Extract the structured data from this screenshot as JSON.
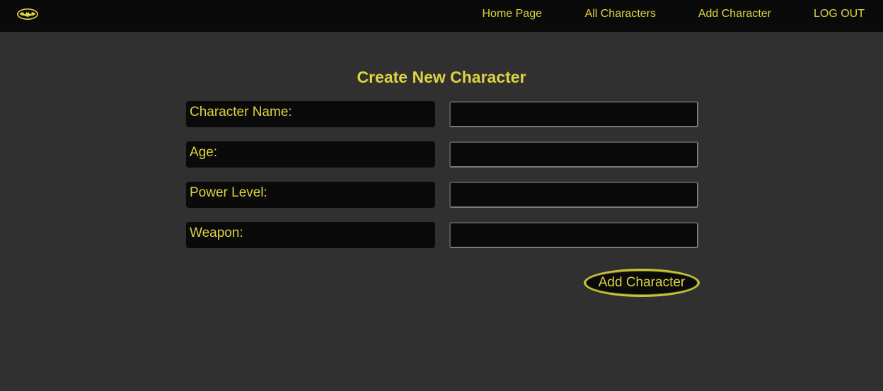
{
  "nav": {
    "logo": "bat-logo-icon",
    "links": [
      {
        "label": "Home Page"
      },
      {
        "label": "All Characters"
      },
      {
        "label": "Add Character"
      },
      {
        "label": "LOG OUT"
      }
    ]
  },
  "form": {
    "title": "Create New Character",
    "fields": [
      {
        "label": "Character Name:",
        "value": ""
      },
      {
        "label": "Age:",
        "value": ""
      },
      {
        "label": "Power Level:",
        "value": ""
      },
      {
        "label": "Weapon:",
        "value": ""
      }
    ],
    "submit_label": "Add Character"
  },
  "colors": {
    "accent": "#dcd441",
    "background": "#303030",
    "navbar": "#0a0a0a",
    "field_background": "#0a0a0a"
  }
}
